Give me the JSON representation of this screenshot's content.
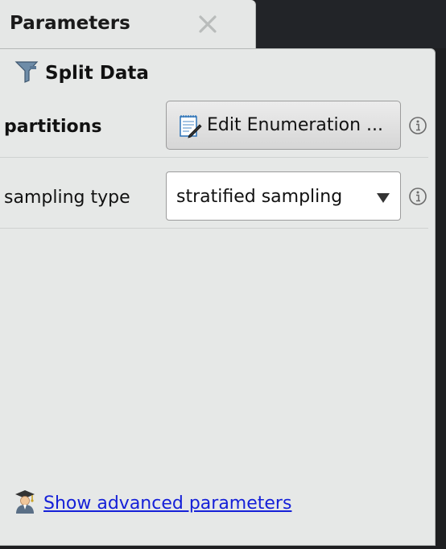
{
  "tab": {
    "title": "Parameters"
  },
  "operator": {
    "name": "Split Data"
  },
  "parameters": [
    {
      "label": "partitions",
      "control": "button",
      "button_label": "Edit Enumeration ..."
    },
    {
      "label": "sampling type",
      "control": "select",
      "value": "stratified sampling"
    }
  ],
  "footer": {
    "advanced_link": "Show advanced parameters"
  },
  "icons": {
    "close": "close-icon",
    "operator": "funnel-icon",
    "enumeration": "notepad-pencil-icon",
    "info": "info-icon",
    "dropdown": "triangle-down-icon",
    "expert": "graduate-user-icon"
  },
  "colors": {
    "panel_bg": "#e6e8e7",
    "link": "#1520d8",
    "backdrop": "#1e1f21"
  }
}
